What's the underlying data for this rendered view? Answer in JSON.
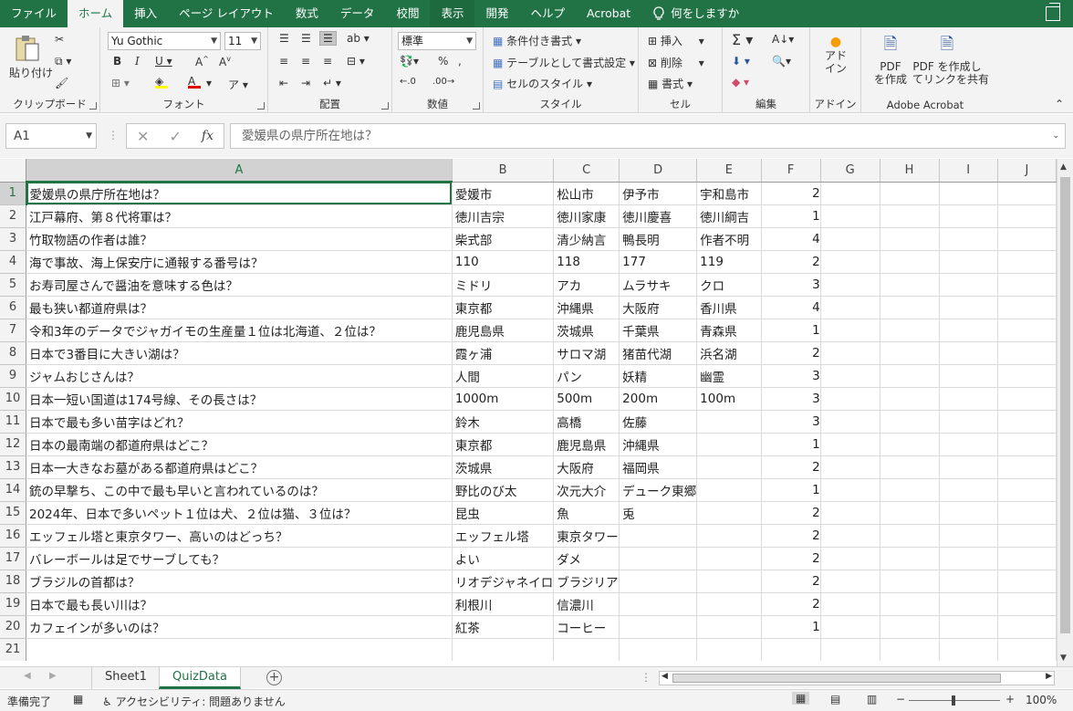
{
  "tabs": [
    "ファイル",
    "ホーム",
    "挿入",
    "ページ レイアウト",
    "数式",
    "データ",
    "校閲",
    "表示",
    "開発",
    "ヘルプ",
    "Acrobat"
  ],
  "active_tab": "ホーム",
  "tell_me": "何をしますか",
  "ribbon": {
    "clipboard": {
      "label": "クリップボード",
      "paste": "貼り付け"
    },
    "font": {
      "label": "フォント",
      "name": "Yu Gothic",
      "size": "11"
    },
    "alignment": {
      "label": "配置"
    },
    "number": {
      "label": "数値",
      "format": "標準"
    },
    "styles": {
      "label": "スタイル",
      "conditional": "条件付き書式",
      "table": "テーブルとして書式設定",
      "cell_styles": "セルのスタイル"
    },
    "cells": {
      "label": "セル",
      "insert": "挿入",
      "delete": "削除",
      "format": "書式"
    },
    "editing": {
      "label": "編集"
    },
    "addins": {
      "label": "アドイン",
      "button": "アド\nイン"
    },
    "acrobat": {
      "label": "Adobe Acrobat",
      "create_pdf": "PDF\nを作成",
      "create_link": "PDF を作成し\nてリンクを共有"
    }
  },
  "formula_bar": {
    "name_box": "A1",
    "formula": "愛媛県の県庁所在地は？"
  },
  "columns": [
    "A",
    "B",
    "C",
    "D",
    "E",
    "F",
    "G",
    "H",
    "I",
    "J"
  ],
  "rows": [
    {
      "n": "1",
      "a": "愛媛県の県庁所在地は？",
      "b": "愛媛市",
      "c": "松山市",
      "d": "伊予市",
      "e": "宇和島市",
      "f": "2"
    },
    {
      "n": "2",
      "a": "江戸幕府、第８代将軍は？",
      "b": "徳川吉宗",
      "c": "徳川家康",
      "d": "徳川慶喜",
      "e": "徳川綱吉",
      "f": "1"
    },
    {
      "n": "3",
      "a": "竹取物語の作者は誰？",
      "b": "柴式部",
      "c": "清少納言",
      "d": "鴨長明",
      "e": "作者不明",
      "f": "4"
    },
    {
      "n": "4",
      "a": "海で事故、海上保安庁に通報する番号は？",
      "b": "110",
      "c": "118",
      "d": "177",
      "e": "119",
      "f": "2"
    },
    {
      "n": "5",
      "a": "お寿司屋さんで醤油を意味する色は？",
      "b": "ミドリ",
      "c": "アカ",
      "d": "ムラサキ",
      "e": "クロ",
      "f": "3"
    },
    {
      "n": "6",
      "a": "最も狭い都道府県は？",
      "b": "東京都",
      "c": "沖縄県",
      "d": "大阪府",
      "e": "香川県",
      "f": "4"
    },
    {
      "n": "7",
      "a": "令和3年のデータでジャガイモの生産量１位は北海道、２位は？",
      "b": "鹿児島県",
      "c": "茨城県",
      "d": "千葉県",
      "e": "青森県",
      "f": "1"
    },
    {
      "n": "8",
      "a": "日本で3番目に大きい湖は？",
      "b": "霞ヶ浦",
      "c": "サロマ湖",
      "d": "猪苗代湖",
      "e": "浜名湖",
      "f": "2"
    },
    {
      "n": "9",
      "a": "ジャムおじさんは？",
      "b": "人間",
      "c": "パン",
      "d": "妖精",
      "e": "幽霊",
      "f": "3"
    },
    {
      "n": "10",
      "a": "日本一短い国道は174号線、その長さは？",
      "b": "1000m",
      "c": "500m",
      "d": "200m",
      "e": "100m",
      "f": "3"
    },
    {
      "n": "11",
      "a": "日本で最も多い苗字はどれ？",
      "b": "鈴木",
      "c": "高橋",
      "d": "佐藤",
      "e": "",
      "f": "3"
    },
    {
      "n": "12",
      "a": "日本の最南端の都道府県はどこ？",
      "b": "東京都",
      "c": "鹿児島県",
      "d": "沖縄県",
      "e": "",
      "f": "1"
    },
    {
      "n": "13",
      "a": "日本一大きなお墓がある都道府県はどこ？",
      "b": "茨城県",
      "c": "大阪府",
      "d": "福岡県",
      "e": "",
      "f": "2"
    },
    {
      "n": "14",
      "a": "銃の早撃ち、この中で最も早いと言われているのは？",
      "b": "野比のび太",
      "c": "次元大介",
      "d": "デューク東郷",
      "e": "",
      "f": "1"
    },
    {
      "n": "15",
      "a": "2024年、日本で多いペット１位は犬、２位は猫、３位は？",
      "b": "昆虫",
      "c": "魚",
      "d": "兎",
      "e": "",
      "f": "2"
    },
    {
      "n": "16",
      "a": "エッフェル塔と東京タワー、高いのはどっち？",
      "b": "エッフェル塔",
      "c": "東京タワー",
      "d": "",
      "e": "",
      "f": "2"
    },
    {
      "n": "17",
      "a": "バレーボールは足でサーブしても？",
      "b": "よい",
      "c": "ダメ",
      "d": "",
      "e": "",
      "f": "2"
    },
    {
      "n": "18",
      "a": "ブラジルの首都は？",
      "b": "リオデジャネイロ",
      "c": "ブラジリア",
      "d": "",
      "e": "",
      "f": "2"
    },
    {
      "n": "19",
      "a": "日本で最も長い川は？",
      "b": "利根川",
      "c": "信濃川",
      "d": "",
      "e": "",
      "f": "2"
    },
    {
      "n": "20",
      "a": "カフェインが多いのは？",
      "b": "紅茶",
      "c": "コーヒー",
      "d": "",
      "e": "",
      "f": "1"
    },
    {
      "n": "21",
      "a": "",
      "b": "",
      "c": "",
      "d": "",
      "e": "",
      "f": ""
    }
  ],
  "sheets": [
    "Sheet1",
    "QuizData"
  ],
  "active_sheet": "QuizData",
  "status": {
    "ready": "準備完了",
    "accessibility": "アクセシビリティ: 問題ありません",
    "zoom": "100%"
  }
}
